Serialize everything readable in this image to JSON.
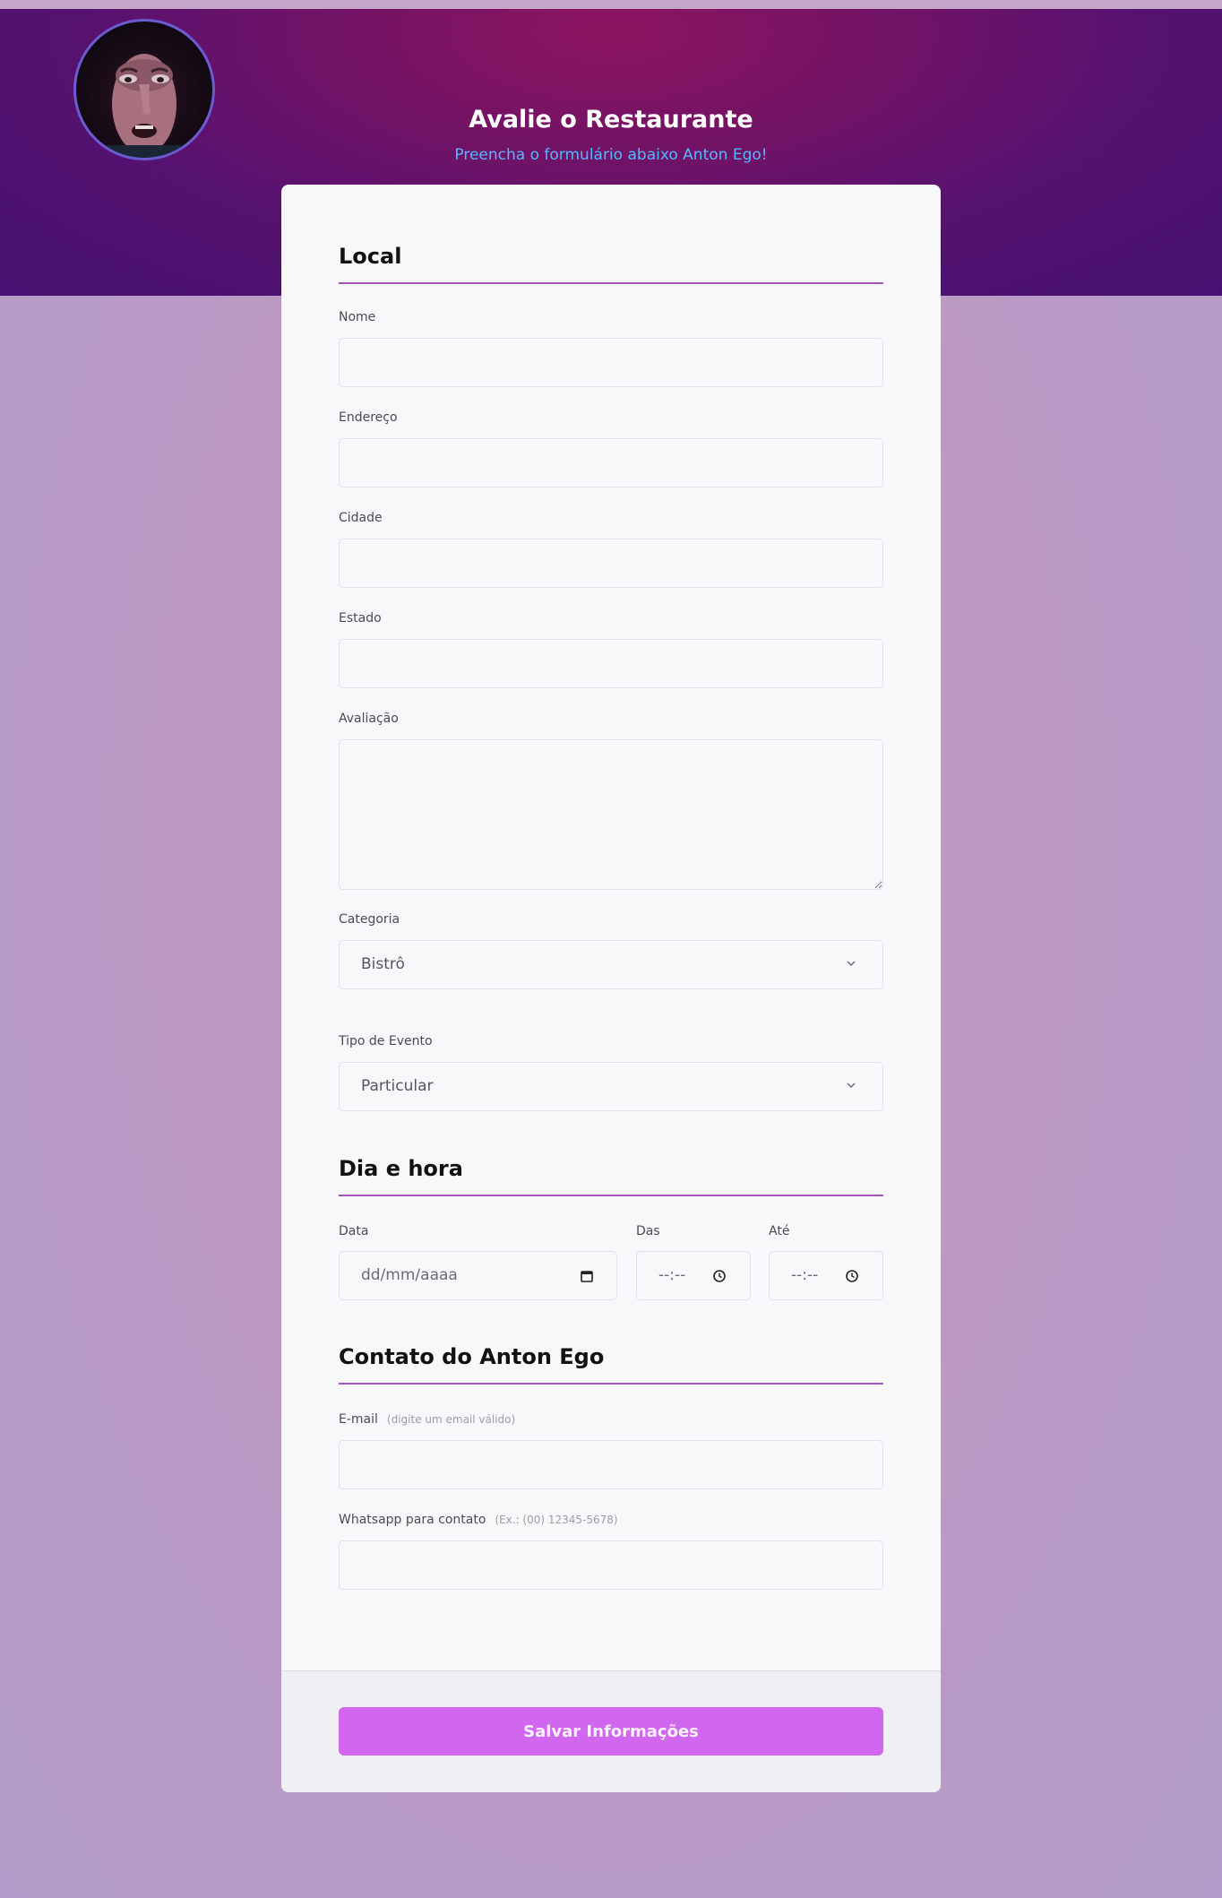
{
  "header": {
    "title": "Avalie o Restaurante",
    "subtitle": "Preencha o formulário abaixo Anton Ego!",
    "avatar_icon": "avatar"
  },
  "sections": {
    "local": "Local",
    "dia_hora": "Dia e hora",
    "contato": "Contato do Anton Ego"
  },
  "fields": {
    "nome": {
      "label": "Nome",
      "value": ""
    },
    "endereco": {
      "label": "Endereço",
      "value": ""
    },
    "cidade": {
      "label": "Cidade",
      "value": ""
    },
    "estado": {
      "label": "Estado",
      "value": ""
    },
    "avaliacao": {
      "label": "Avaliação",
      "value": ""
    },
    "categoria": {
      "label": "Categoria",
      "selected": "Bistrô"
    },
    "tipo_evento": {
      "label": "Tipo de Evento",
      "selected": "Particular"
    },
    "data": {
      "label": "Data",
      "placeholder": "dd/mm/aaaa"
    },
    "das": {
      "label": "Das",
      "placeholder": "--:--"
    },
    "ate": {
      "label": "Até",
      "placeholder": "--:--"
    },
    "email": {
      "label": "E-mail",
      "hint": "(digite um email válido)",
      "value": ""
    },
    "whatsapp": {
      "label": "Whatsapp para contato",
      "hint": "(Ex.: (00) 12345-5678)",
      "value": ""
    }
  },
  "footer": {
    "save_label": "Salvar Informações"
  },
  "colors": {
    "accent_button": "#d167ee",
    "section_rule": "#a257c0",
    "subtitle": "#55b7ff"
  }
}
